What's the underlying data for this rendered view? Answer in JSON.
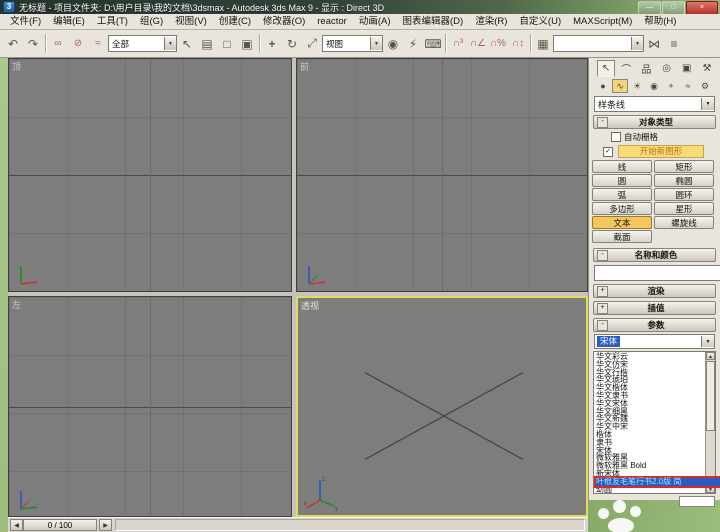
{
  "window": {
    "icon": "3",
    "title": "无标题    - 项目文件夹: D:\\用户目录\\我的文档\\3dsmax    - Autodesk 3ds Max 9    - 显示 : Direct 3D"
  },
  "icons": {
    "minimize": "—",
    "maximize": "□",
    "close": "×",
    "undo": "↶",
    "redo": "↷",
    "link": "∞",
    "unlink": "⊘",
    "bind": "≈",
    "select": "↖",
    "select_by_name": "▤",
    "rect_region": "□",
    "crossing": "▣",
    "move": "+",
    "rotate": "↻",
    "scale": "⤢",
    "use_center": "◉",
    "manipulate": "⚡",
    "keyboard": "⌨",
    "snap3": "∩³",
    "snap_angle": "∩∠",
    "snap_percent": "∩%",
    "snap_spinner": "∩↕",
    "edit_named": "▦",
    "mirror": "⋈",
    "align": "≡",
    "dropdown": "▼",
    "scroll_up": "▲",
    "scroll_down": "▼",
    "check": "✓",
    "minus": "-",
    "plus": "+",
    "prev": "◀",
    "next": "▶",
    "tab_create": "↖",
    "tab_modify": "⌒",
    "tab_hierarchy": "品",
    "tab_motion": "◎",
    "tab_display": "▣",
    "tab_utilities": "⚒",
    "cat_geometry": "●",
    "cat_shapes": "∿",
    "cat_lights": "☀",
    "cat_cameras": "◉",
    "cat_helpers": "+",
    "cat_spacewarps": "≈",
    "cat_systems": "⚙"
  },
  "menubar": {
    "items": [
      "文件(F)",
      "编辑(E)",
      "工具(T)",
      "组(G)",
      "视图(V)",
      "创建(C)",
      "修改器(O)",
      "reactor",
      "动画(A)",
      "图表编辑器(D)",
      "渲染(R)",
      "自定义(U)",
      "MAXScript(M)",
      "帮助(H)"
    ]
  },
  "toolbar": {
    "selection_filter": "全部",
    "reference_coordsys": "视图",
    "named_selection": ""
  },
  "viewports": {
    "top": {
      "label": "顶"
    },
    "front": {
      "label": "前"
    },
    "left": {
      "label": "左"
    },
    "perspective": {
      "label": "透视"
    }
  },
  "axis_labels": {
    "x": "x",
    "y": "y",
    "z": "z"
  },
  "command_panel": {
    "category_select": "样条线",
    "object_type": {
      "title": "对象类型",
      "autogrid": "自动栅格",
      "start_new_shape": "开始新图形",
      "buttons": [
        {
          "label": "线"
        },
        {
          "label": "矩形"
        },
        {
          "label": "圆"
        },
        {
          "label": "椭圆"
        },
        {
          "label": "弧"
        },
        {
          "label": "圆环"
        },
        {
          "label": "多边形"
        },
        {
          "label": "星形"
        },
        {
          "label": "文本",
          "active": true
        },
        {
          "label": "螺旋线"
        },
        {
          "label": "截面"
        }
      ]
    },
    "name_and_color": {
      "title": "名称和颜色",
      "value": ""
    },
    "rendering_title": "渲染",
    "interpolation_title": "插值",
    "parameters_title": "参数",
    "font_combo": "宋体",
    "font_list": [
      {
        "label": "华文彩云"
      },
      {
        "label": "华文仿宋"
      },
      {
        "label": "华文行楷"
      },
      {
        "label": "华文琥珀"
      },
      {
        "label": "华文楷体"
      },
      {
        "label": "华文隶书"
      },
      {
        "label": "华文宋体"
      },
      {
        "label": "华文细黑"
      },
      {
        "label": "华文新魏"
      },
      {
        "label": "华文中宋"
      },
      {
        "label": "楷体"
      },
      {
        "label": "隶书"
      },
      {
        "label": "宋体"
      },
      {
        "label": "微软雅黑"
      },
      {
        "label": "微软雅黑 Bold"
      },
      {
        "label": "新宋体"
      },
      {
        "label": "叶根友毛笔行书2.0版 简",
        "selected": true
      },
      {
        "label": "幼圆"
      }
    ]
  },
  "timeline": {
    "frame": "0 / 100"
  },
  "colors": {
    "active_button": "#f3c75c",
    "highlight_yellow": "#f8da79",
    "selection_blue": "#2c5cc0",
    "annotation_red": "#d62b2b",
    "object_color": "#e25050",
    "active_viewport_border": "#e3da5c"
  }
}
